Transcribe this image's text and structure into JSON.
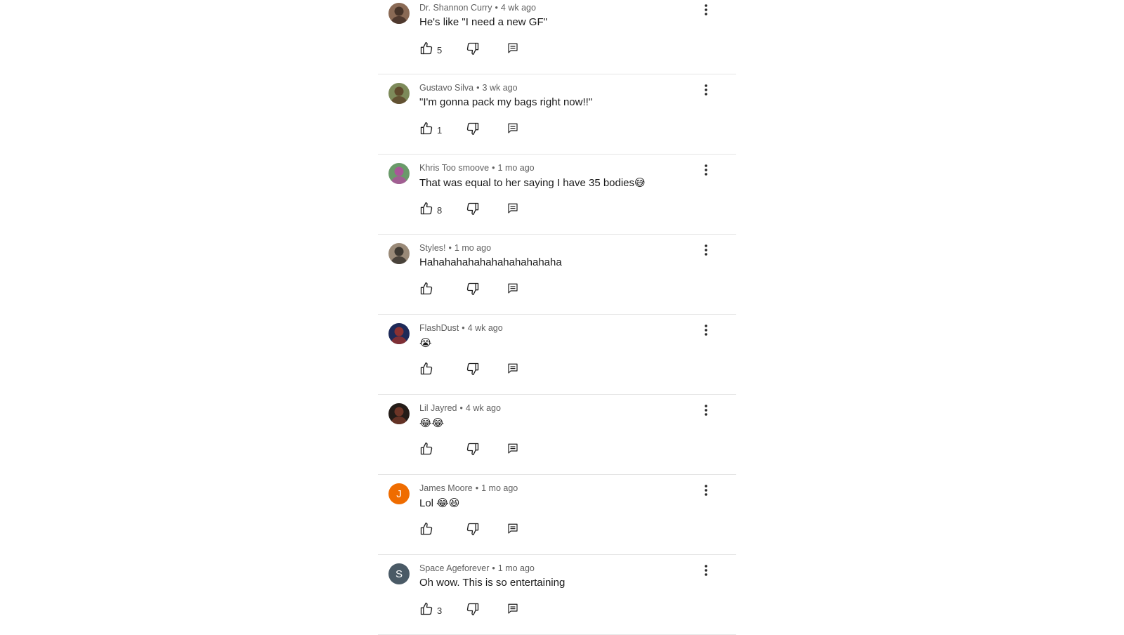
{
  "comments": [
    {
      "author": "Dr. Shannon Curry",
      "time": "4 wk ago",
      "text": "He's like \"I need a new GF\"",
      "likes": "5",
      "avatar": {
        "kind": "photo",
        "bg": "#8a6a55",
        "fg": "#3b2a22"
      }
    },
    {
      "author": "Gustavo Silva",
      "time": "3 wk ago",
      "text": "\"I'm gonna pack my bags right now!!\"",
      "likes": "1",
      "avatar": {
        "kind": "photo",
        "bg": "#7d8a5a",
        "fg": "#5a3e26"
      }
    },
    {
      "author": "Khris Too smoove",
      "time": "1 mo ago",
      "text": "That was equal to her saying I have 35 bodies😅",
      "likes": "8",
      "avatar": {
        "kind": "photo",
        "bg": "#6a9a6a",
        "fg": "#b44aa0"
      }
    },
    {
      "author": "Styles!",
      "time": "1 mo ago",
      "text": "Hahahahahahahahahahahaha",
      "likes": "",
      "avatar": {
        "kind": "photo",
        "bg": "#9a8a78",
        "fg": "#2e2a26"
      }
    },
    {
      "author": "FlashDust",
      "time": "4 wk ago",
      "text": "😭",
      "likes": "",
      "avatar": {
        "kind": "photo",
        "bg": "#1e2a58",
        "fg": "#a0322a"
      }
    },
    {
      "author": "Lil Jayred",
      "time": "4 wk ago",
      "text": "😂😂",
      "likes": "",
      "avatar": {
        "kind": "photo",
        "bg": "#241c18",
        "fg": "#7a3a2a"
      }
    },
    {
      "author": "James Moore",
      "time": "1 mo ago",
      "text": "Lol 😂😆",
      "likes": "",
      "avatar": {
        "kind": "letter",
        "letter": "J",
        "bg": "#ef6c00"
      }
    },
    {
      "author": "Space Ageforever",
      "time": "1 mo ago",
      "text": "Oh wow.  This is so entertaining",
      "likes": "3",
      "avatar": {
        "kind": "letter",
        "letter": "S",
        "bg": "#4a5a66"
      }
    }
  ],
  "separator": "•",
  "icons": {
    "like": "thumb-up-icon",
    "dislike": "thumb-down-icon",
    "reply": "reply-comment-icon",
    "menu": "more-vert-icon"
  }
}
